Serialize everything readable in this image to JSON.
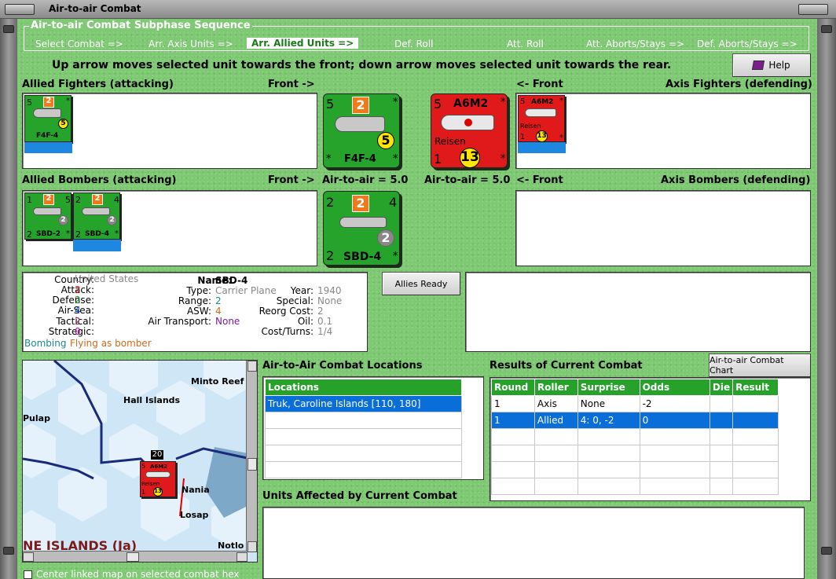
{
  "window": {
    "title": "Air-to-air Combat"
  },
  "subphase": {
    "title": "Air-to-air Combat Subphase Sequence",
    "steps": [
      "Select Combat =>",
      "Arr. Axis Units =>",
      "Arr. Allied Units =>",
      "Def. Roll",
      "Att. Roll",
      "Att. Aborts/Stays =>",
      "Def. Aborts/Stays =>"
    ]
  },
  "instruction": "Up arrow moves selected unit towards the front; down arrow moves selected unit towards the rear.",
  "help_label": "Help",
  "labels": {
    "allied_fighters": "Allied Fighters (attacking)",
    "front_right": "Front ->",
    "front_left": "<- Front",
    "axis_fighters": "Axis Fighters (defending)",
    "allied_bombers": "Allied Bombers (attacking)",
    "axis_bombers": "Axis Bombers (defending)",
    "allied_a2a": "Air-to-air = 5.0",
    "axis_a2a": "Air-to-air = 5.0"
  },
  "units": {
    "f4f": {
      "name": "F4F-4",
      "attack": "5",
      "defense": "2",
      "a2a": "5",
      "star": "*"
    },
    "a6m2": {
      "name": "A6M2",
      "sub": "Reisen",
      "attack": "5",
      "range": "1",
      "a2a": "13",
      "star": "*"
    },
    "sbd2": {
      "name": "SBD-2",
      "attack": "1",
      "defense": "2",
      "range": "5",
      "bomb": "2",
      "bottom": "2",
      "star": "*"
    },
    "sbd4": {
      "name": "SBD-4",
      "attack": "2",
      "defense": "2",
      "range": "4",
      "bomb": "2",
      "bottom": "2",
      "star": "*"
    }
  },
  "info": {
    "country_k": "Country:",
    "country_v": "United States",
    "attack_k": "Attack:",
    "attack_v": "2",
    "defense_k": "Defense:",
    "defense_v": "2",
    "airsea_k": "Air-Sea:",
    "airsea_v": "4",
    "tactical_k": "Tactical:",
    "tactical_v": "2",
    "strategic_k": "Strategic:",
    "strategic_v": "0",
    "bombing": "Bombing",
    "flying": "Flying as bomber",
    "name_k": "Name:",
    "name_v": "SBD-4",
    "type_k": "Type:",
    "type_v": "Carrier Plane",
    "range_k": "Range:",
    "range_v": "2",
    "asw_k": "ASW:",
    "asw_v": "4",
    "airtrans_k": "Air Transport:",
    "airtrans_v": "None",
    "year_k": "Year:",
    "year_v": "1940",
    "special_k": "Special:",
    "special_v": "None",
    "reorg_k": "Reorg Cost:",
    "reorg_v": "2",
    "oil_k": "Oil:",
    "oil_v": "0.1",
    "cost_k": "Cost/Turns:",
    "cost_v": "1/4"
  },
  "allies_ready": "Allies Ready",
  "chart_btn": "Air-to-air Combat Chart",
  "locations": {
    "title": "Air-to-Air Combat Locations",
    "header": "Locations",
    "rows": [
      "Truk, Caroline Islands [110, 180]"
    ]
  },
  "results": {
    "title": "Results of Current Combat",
    "headers": [
      "Round",
      "Roller",
      "Surprise",
      "Odds",
      "Die",
      "Result"
    ],
    "rows": [
      [
        "1",
        "Axis",
        "None",
        "-2",
        "",
        ""
      ],
      [
        "1",
        "Allied",
        "4: 0, -2",
        "0",
        "",
        ""
      ]
    ]
  },
  "affected_title": "Units Affected by Current Combat",
  "map": {
    "labels": [
      "Minto Reef",
      "Hall Islands",
      "Pulap",
      "Nania",
      "Losap",
      "Notlo",
      "NE ISLANDS (Ja)"
    ],
    "stack": "20",
    "counter": {
      "name": "A6M2",
      "sub": "Reisen",
      "attack": "5",
      "range": "1",
      "a2a": "13"
    }
  },
  "center_map": "Center linked map on selected combat hex",
  "colors": {
    "felt": "#7fc874",
    "allied": "#25a32a",
    "axis": "#e01a1a",
    "select": "#0a6ed8"
  }
}
